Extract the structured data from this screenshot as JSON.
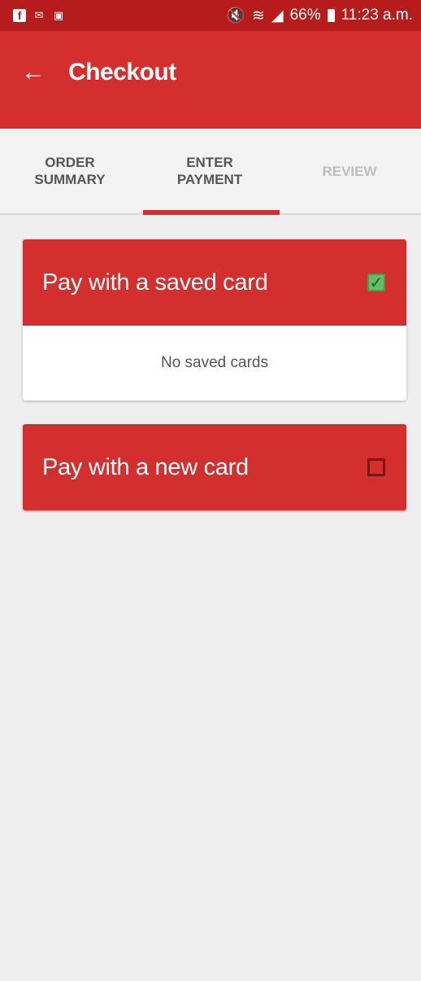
{
  "status_bar": {
    "time": "11:23 a.m.",
    "battery": "66%",
    "icons": [
      "facebook-icon",
      "mail-icon",
      "image-icon",
      "mute-icon",
      "wifi-icon",
      "signal-icon",
      "battery-icon"
    ]
  },
  "app_bar": {
    "title": "Checkout",
    "back_icon": "back-arrow-icon"
  },
  "tabs": [
    {
      "label": "ORDER\nSUMMARY",
      "state": "normal"
    },
    {
      "label": "ENTER\nPAYMENT",
      "state": "active"
    },
    {
      "label": "REVIEW",
      "state": "disabled"
    }
  ],
  "saved_card": {
    "title": "Pay with a saved card",
    "checked": true,
    "empty_message": "No saved cards"
  },
  "new_card": {
    "title": "Pay with a new card",
    "checked": false
  },
  "colors": {
    "primary": "#d32f2f",
    "status_bar": "#b71c1c",
    "background": "#efefef",
    "checkbox_checked": "#66bb6a"
  }
}
